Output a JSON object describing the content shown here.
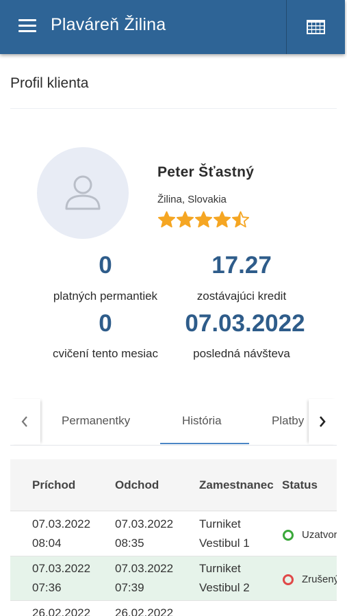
{
  "app": {
    "title": "Plaváreň Žilina",
    "menu_icon": "hamburger-menu-icon",
    "grid_icon": "calendar-grid-icon"
  },
  "page": {
    "title": "Profil klienta"
  },
  "profile": {
    "name": "Peter Šťastný",
    "location": "Žilina, Slovakia",
    "rating": 4.5,
    "rating_max": 5,
    "star_color": "#f5a623",
    "stats": [
      {
        "value": "0",
        "label": "platných permantiek"
      },
      {
        "value": "17.27",
        "label": "zostávajúci kredit"
      },
      {
        "value": "0",
        "label": "cvičení tento mesiac"
      },
      {
        "value": "07.03.2022",
        "label": "posledná návšteva"
      }
    ]
  },
  "tabs": {
    "items": [
      {
        "label": "Permanentky"
      },
      {
        "label": "História"
      },
      {
        "label": "Platby"
      }
    ],
    "active": "História",
    "accent": "#4a86c5"
  },
  "table": {
    "headers": [
      "Príchod",
      "Odchod",
      "Zamestnanec",
      "Status"
    ],
    "rows": [
      {
        "in_date": "07.03.2022",
        "in_time": "08:04",
        "out_date": "07.03.2022",
        "out_time": "08:35",
        "emp_1": "Turniket",
        "emp_2": "Vestibul 1",
        "status": "Uzatvorený",
        "status_color": "#3aa83a"
      },
      {
        "in_date": "07.03.2022",
        "in_time": "07:36",
        "out_date": "07.03.2022",
        "out_time": "07:39",
        "emp_1": "Turniket",
        "emp_2": "Vestibul 2",
        "status": "Zrušený",
        "status_color": "#e04848"
      },
      {
        "in_date": "26.02.2022",
        "in_time": "",
        "out_date": "26.02.2022",
        "out_time": "",
        "emp_1": "",
        "emp_2": "",
        "status": "",
        "status_color": ""
      }
    ]
  },
  "colors": {
    "primary": "#2e6496",
    "stat_number": "#2e5c8a",
    "row_highlight": "#e6f3ea"
  }
}
